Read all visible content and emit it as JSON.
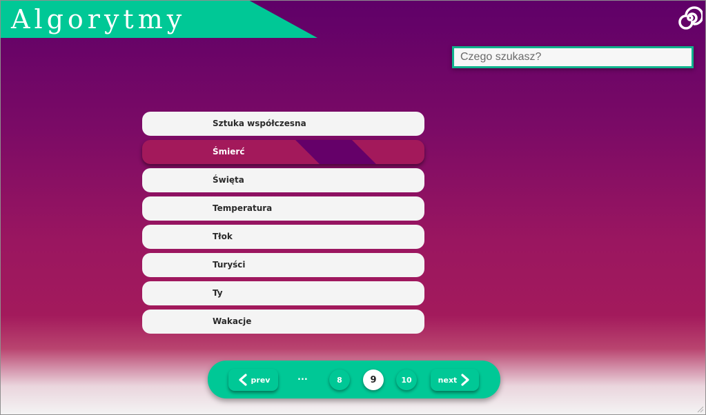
{
  "header": {
    "title": "Algorytmy"
  },
  "search": {
    "placeholder": "Czego szukasz?"
  },
  "topics": [
    {
      "label": "Sztuka współczesna",
      "active": false
    },
    {
      "label": "Śmierć",
      "active": true
    },
    {
      "label": "Święta",
      "active": false
    },
    {
      "label": "Temperatura",
      "active": false
    },
    {
      "label": "Tłok",
      "active": false
    },
    {
      "label": "Turyści",
      "active": false
    },
    {
      "label": "Ty",
      "active": false
    },
    {
      "label": "Wakacje",
      "active": false
    }
  ],
  "pagination": {
    "prev_label": "prev",
    "next_label": "next",
    "ellipsis": "...",
    "pages": [
      "8",
      "9",
      "10"
    ],
    "current_page": "9"
  },
  "colors": {
    "accent": "#00c896",
    "active_item": "#a3195b",
    "background_top": "#5f0068"
  },
  "icons": {
    "logo": "spiral-icon",
    "prev": "chevron-left-icon",
    "next": "chevron-right-icon"
  }
}
